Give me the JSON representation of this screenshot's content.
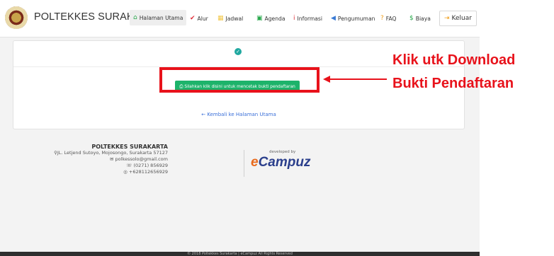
{
  "brand": {
    "name": "POLTEKKES SURAKARTA"
  },
  "nav": [
    {
      "label": "Halaman Utama",
      "icon": "home-icon",
      "glyph": "⌂",
      "color": "#27a84b",
      "active": true
    },
    {
      "label": "Alur",
      "icon": "check-icon",
      "glyph": "✔",
      "color": "#e0303a"
    },
    {
      "label": "Jadwal",
      "icon": "calendar-icon",
      "glyph": "▦",
      "color": "#f2c84b"
    },
    {
      "label": "Agenda",
      "icon": "calendar-check-icon",
      "glyph": "▣",
      "color": "#27a84b"
    },
    {
      "label": "Informasi",
      "icon": "info-icon",
      "glyph": "i",
      "color": "#e0303a"
    },
    {
      "label": "Pengumuman",
      "icon": "megaphone-icon",
      "glyph": "◀",
      "color": "#3a7bd5"
    },
    {
      "label": "FAQ",
      "icon": "question-icon",
      "glyph": "?",
      "color": "#f0a020"
    },
    {
      "label": "Biaya",
      "icon": "dollar-icon",
      "glyph": "$",
      "color": "#27a84b"
    }
  ],
  "logout": {
    "label": "Keluar",
    "icon": "sign-out-icon",
    "glyph": "⇥",
    "color": "#f0a020"
  },
  "card": {
    "print_button": "Silahkan klik disini untuk mencetak bukti pendaftaran",
    "back_link": "Kembali ke Halaman Utama"
  },
  "annotation": {
    "line1": "Klik utk Download",
    "line2": "Bukti  Pendaftaran",
    "color": "#e8121b"
  },
  "footer": {
    "title": "POLTEKKES SURAKARTA",
    "address": "JL. Letjend Sutoyo, Mojosongo, Surakarta 57127",
    "email": "polkessolo@gmail.com",
    "phone": "(0271) 856929",
    "whatsapp": "+628112656929",
    "developed_by": "developed by",
    "dev_name_prefix": "e",
    "dev_name_rest": "Campuz"
  },
  "copyright": "© 2018 Poltekkes Surakarta | eCampuz All Rights Reserved"
}
